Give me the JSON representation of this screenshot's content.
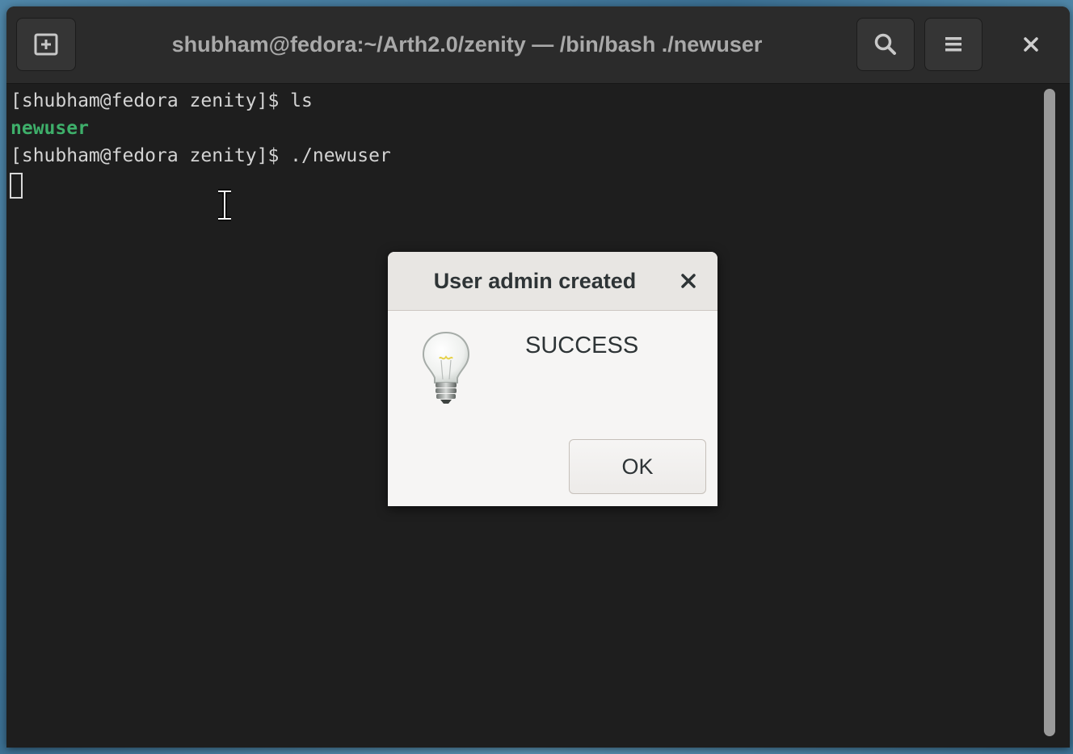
{
  "window": {
    "title": "shubham@fedora:~/Arth2.0/zenity — /bin/bash ./newuser",
    "buttons": {
      "new_tab_icon": "new-tab-icon",
      "search_icon": "search-icon",
      "menu_icon": "hamburger-menu-icon",
      "close_icon": "close-icon"
    }
  },
  "terminal": {
    "lines": [
      "[shubham@fedora zenity]$ ls",
      "newuser",
      "[shubham@fedora zenity]$ ./newuser"
    ],
    "colors": {
      "background": "#1e1e1e",
      "text": "#d3d3d3",
      "executable": "#3eaf6a"
    }
  },
  "dialog": {
    "title": "User admin created",
    "message": "SUCCESS",
    "ok_label": "OK",
    "icon": "lightbulb-icon",
    "close_icon": "close-icon"
  }
}
